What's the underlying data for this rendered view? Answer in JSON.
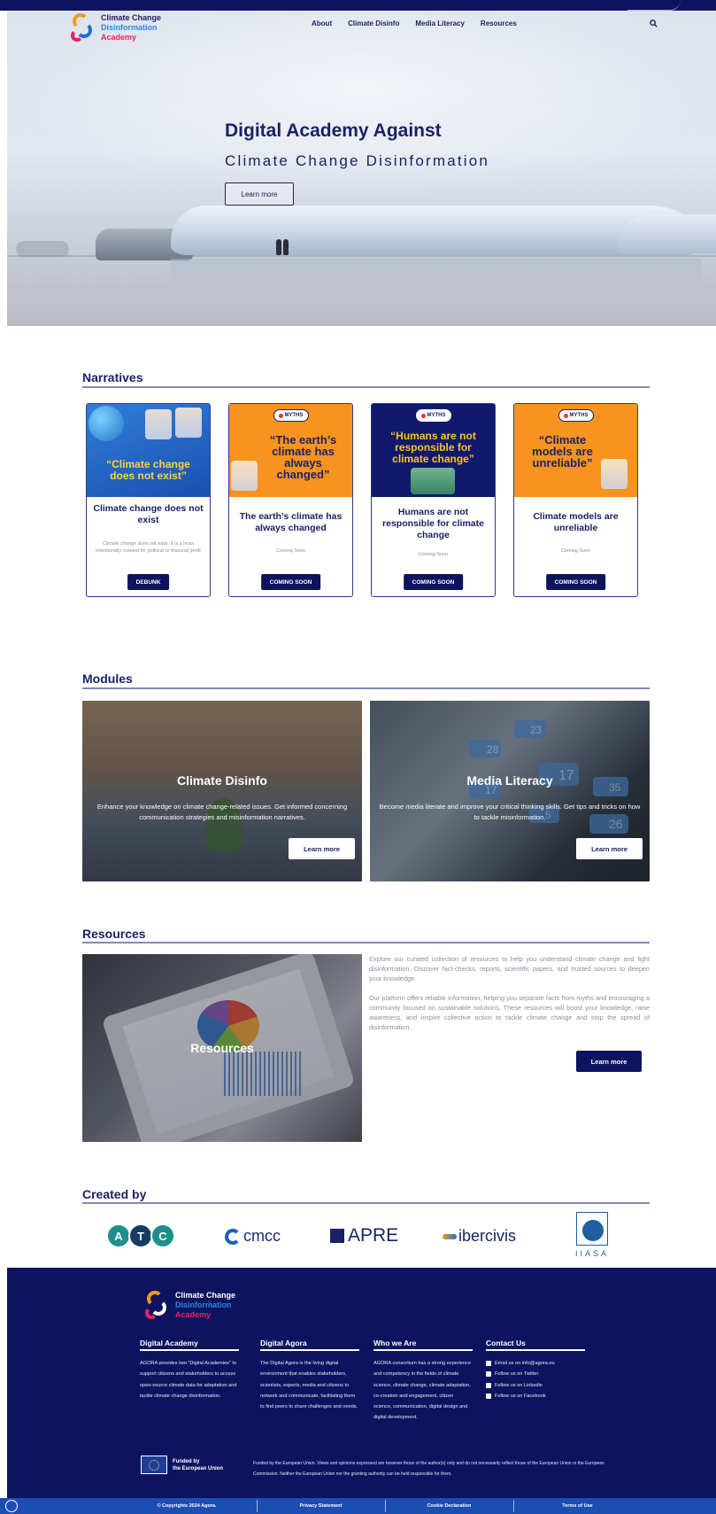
{
  "site": {
    "logo": {
      "line1": "Climate Change",
      "line2": "Disinformation",
      "line3": "Academy"
    },
    "nav": [
      "About",
      "Climate Disinfo",
      "Media Literacy",
      "Resources"
    ]
  },
  "hero": {
    "title": "Digital Academy Against",
    "subtitle": "Climate Change Disinformation",
    "button": "Learn more"
  },
  "narratives": {
    "heading": "Narratives",
    "myths_badge": "MYTHS",
    "cards": [
      {
        "image_text": "“Climate change does not exist”",
        "title": "Climate change does not exist",
        "desc": "Climate change does not exist. It is a hoax intentionally created for political or financial profit",
        "button": "DEBUNK"
      },
      {
        "image_text": "“The earth’s climate has always changed”",
        "title": "The earth’s climate has always changed",
        "desc": "Coming Soon",
        "button": "COMING SOON"
      },
      {
        "image_text": "“Humans are not responsible for climate change”",
        "title": "Humans are not responsible for climate change",
        "desc": "Coming Soon",
        "button": "COMING SOON"
      },
      {
        "image_text": "“Climate models are unreliable”",
        "title": "Climate models are unreliable",
        "desc": "Coming Soon",
        "button": "COMING SOON"
      }
    ]
  },
  "modules": {
    "heading": "Modules",
    "items": [
      {
        "title": "Climate Disinfo",
        "desc": "Enhance your knowledge on climate change-related issues. Get informed concerning communication strategies and misinformation narratives.",
        "button": "Learn more"
      },
      {
        "title": "Media Literacy",
        "desc": "Become media literate and improve your critical thinking skills. Get tips and tricks on how to tackle misinformation.",
        "button": "Learn more"
      }
    ],
    "social_counts": [
      "23",
      "28",
      "17",
      "17",
      "35",
      "5",
      "26"
    ]
  },
  "resources": {
    "heading": "Resources",
    "image_title": "Resources",
    "para1": "Explore our curated collection of resources to help you understand climate change and fight disinformation. Discover fact-checks, reports, scientific papers, and trusted sources to deepen your knowledge.",
    "para2": "Our platform offers reliable information, helping you separate facts from myths and encouraging a community focused on sustainable solutions. These resources will boost your knowledge, raise awareness, and inspire collective action to tackle climate change and stop the spread of disinformation.",
    "button": "Learn more"
  },
  "created_by": {
    "heading": "Created by",
    "atc": [
      "A",
      "T",
      "C"
    ],
    "cmcc": "cmcc",
    "apre": "APRE",
    "ibercivis": "ibercivis",
    "iiasa": "IIASA"
  },
  "footer": {
    "columns": [
      {
        "heading": "Digital Academy",
        "body": "AGORA provides two \"Digital Academies\" to support citizens and stakeholders to access open-source climate data for adaptation and tackle climate change disinformation."
      },
      {
        "heading": "Digital Agora",
        "body": "The Digital Agora is the living digital environment that enables stakeholders, scientists, experts, media and citizens to network and communicate, facilitating them to find peers to share challenges and needs."
      },
      {
        "heading": "Who we Are",
        "body": "AGORA consortium has a strong experience and competency in the fields of climate science, climate change, climate adaptation, co-creation and engagement, citizen science, communication, digital design and digital development."
      }
    ],
    "contact": {
      "heading": "Contact Us",
      "items": [
        "Email us on info@agora.eu",
        "Follow us on Twitter",
        "Follow us on Linkedin",
        "Follow us on Facebook"
      ]
    },
    "eu_label_1": "Funded by",
    "eu_label_2": "the European Union",
    "eu_disclaimer": "Funded by the European Union. Views and opinions expressed are however those of the author(s) only and do not necessarily reflect those of the European Union or the European Commission. Neither the European Union nor the granting authority can be held responsible for them."
  },
  "bottom_bar": {
    "copyright": "© Copyrights 2024 Agora.",
    "privacy": "Privacy Statement",
    "cookie": "Cookie Declaration",
    "terms": "Terms of Use"
  },
  "colors": {
    "navy": "#0d145f",
    "orange": "#f7931e",
    "blue_bar": "#1c4db3",
    "pink": "#e3245f",
    "light_blue": "#2f86e0"
  }
}
